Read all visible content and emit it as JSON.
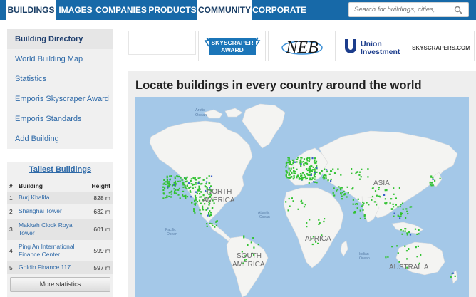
{
  "nav": {
    "tabs": [
      {
        "label": "BUILDINGS",
        "active": true
      },
      {
        "label": "IMAGES"
      },
      {
        "label": "COMPANIES"
      },
      {
        "label": "PRODUCTS"
      },
      {
        "label": "COMMUNITY",
        "active": true
      },
      {
        "label": "CORPORATE"
      }
    ],
    "search_placeholder": "Search for buildings, cities, ..."
  },
  "sidebar": {
    "items": [
      {
        "label": "Building Directory",
        "active": true
      },
      {
        "label": "World Building Map"
      },
      {
        "label": "Statistics"
      },
      {
        "label": "Emporis Skyscraper Award"
      },
      {
        "label": "Emporis Standards"
      },
      {
        "label": "Add Building"
      }
    ]
  },
  "tallest": {
    "heading": "Tallest Buildings",
    "col_num": "#",
    "col_building": "Building",
    "col_height": "Height",
    "rows": [
      {
        "num": "1",
        "name": "Burj Khalifa",
        "height": "828 m"
      },
      {
        "num": "2",
        "name": "Shanghai Tower",
        "height": "632 m"
      },
      {
        "num": "3",
        "name": "Makkah Clock Royal Tower",
        "height": "601 m"
      },
      {
        "num": "4",
        "name": "Ping An International Finance Center",
        "height": "599 m"
      },
      {
        "num": "5",
        "name": "Goldin Finance 117",
        "height": "597 m"
      }
    ],
    "more_button": "More statistics"
  },
  "banners": {
    "award_line1": "SKYSCRAPER",
    "award_line2": "AWARD",
    "neb": "NEB",
    "union_line1": "Union",
    "union_line2": "Investment",
    "skyscrapers": "SKYSCRAPERS.COM"
  },
  "map": {
    "title": "Locate buildings in every country around the world",
    "labels": {
      "arctic": "Arctic",
      "ocean": "Ocean",
      "north": "NORTH",
      "america": "AMERICA",
      "asia": "ASIA",
      "africa": "AFRICA",
      "south": "SOUTH",
      "samerica": "AMERICA",
      "australia": "AUSTRALIA",
      "atlantic": "Atlantic",
      "pacific": "Pacific",
      "indian": "Indian"
    },
    "colors": {
      "water": "#a4c8e8",
      "land": "#f4f4f2",
      "marker": "#33c233",
      "marker_alt": "#3a5fc9"
    }
  }
}
